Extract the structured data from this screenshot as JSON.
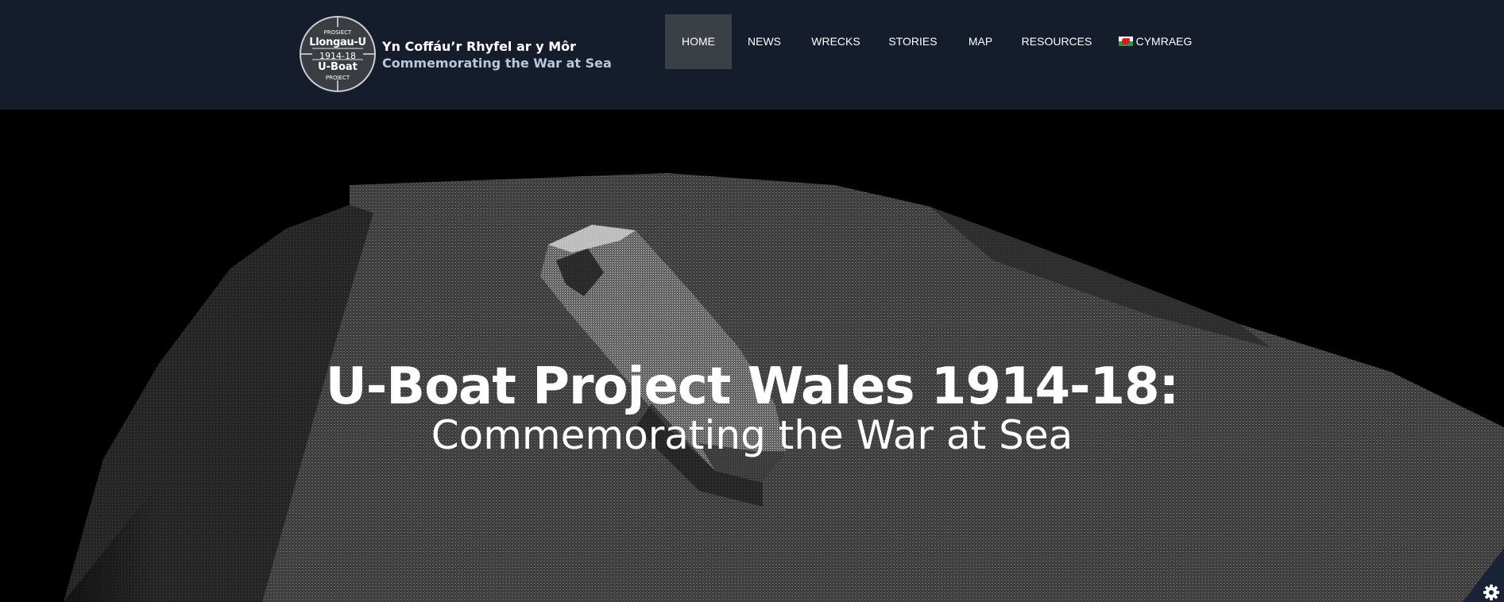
{
  "logo": {
    "line1": "PROSIECT",
    "line2": "Llongau-U",
    "line3": "1914-18",
    "line4": "U-Boat",
    "line5": "PROJECT"
  },
  "tagline": {
    "welsh": "Yn Coffáu’r Rhyfel ar y Môr",
    "english": "Commemorating the War at Sea"
  },
  "nav": {
    "items": [
      {
        "label": "HOME",
        "active": true
      },
      {
        "label": "NEWS"
      },
      {
        "label": "WRECKS"
      },
      {
        "label": "STORIES"
      },
      {
        "label": "MAP"
      },
      {
        "label": "RESOURCES"
      },
      {
        "label": "CYMRAEG",
        "icon": "welsh-flag-icon"
      }
    ]
  },
  "hero": {
    "title": "U-Boat Project Wales 1914-18:",
    "subtitle": "Commemorating the War at Sea"
  },
  "cookie": {
    "icon": "gear-icon"
  },
  "colors": {
    "header_bg": "#151d2d",
    "nav_active_bg": "#3b4047",
    "tagline_english": "#b9c8d9",
    "hero_bg": "#000000"
  }
}
